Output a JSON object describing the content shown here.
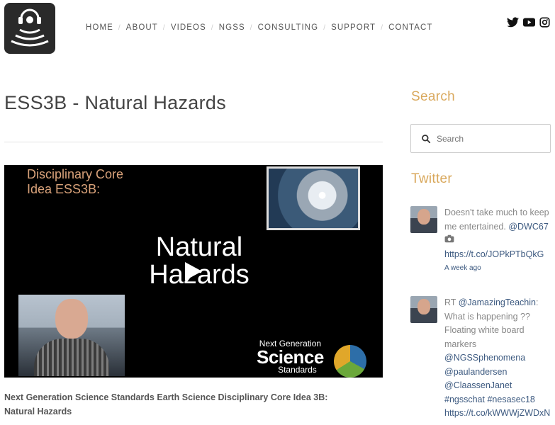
{
  "header": {
    "nav": [
      "HOME",
      "ABOUT",
      "VIDEOS",
      "NGSS",
      "CONSULTING",
      "SUPPORT",
      "CONTACT"
    ],
    "social": [
      "twitter-icon",
      "youtube-icon",
      "instagram-icon"
    ]
  },
  "main": {
    "title": "ESS3B - Natural Hazards",
    "video": {
      "core_line1": "Disciplinary Core",
      "core_line2": "Idea ESS3B:",
      "title_line1": "Natural",
      "title_line2": "Hazards",
      "ngss_small": "Next Generation",
      "ngss_big": "Science",
      "ngss_std": "Standards"
    },
    "caption": "Next Generation Science Standards Earth Science Disciplinary Core Idea 3B:  Natural Hazards"
  },
  "sidebar": {
    "search_heading": "Search",
    "search_placeholder": "Search",
    "twitter_heading": "Twitter",
    "tweet1": {
      "text": "Doesn't take much to keep me entertained. ",
      "mention": "@DWC67",
      "link": "https://t.co/JOPkPTbQkG",
      "time": "A week ago"
    },
    "tweet2": {
      "prefix": "RT ",
      "mention1": "@JamazingTeachin",
      "text": ": What is happening ?? Floating white board markers ",
      "mention2": "@NGSSphenomena",
      "mention3": "@paulandersen",
      "mention4": "@ClaassenJanet",
      "tag1": "#ngsschat",
      "tag2": "#nesasec18",
      "link": "https://t.co/kWWWjZWDxN"
    }
  },
  "colors": {
    "accent": "#d9a85c",
    "link": "#3d5a80"
  }
}
